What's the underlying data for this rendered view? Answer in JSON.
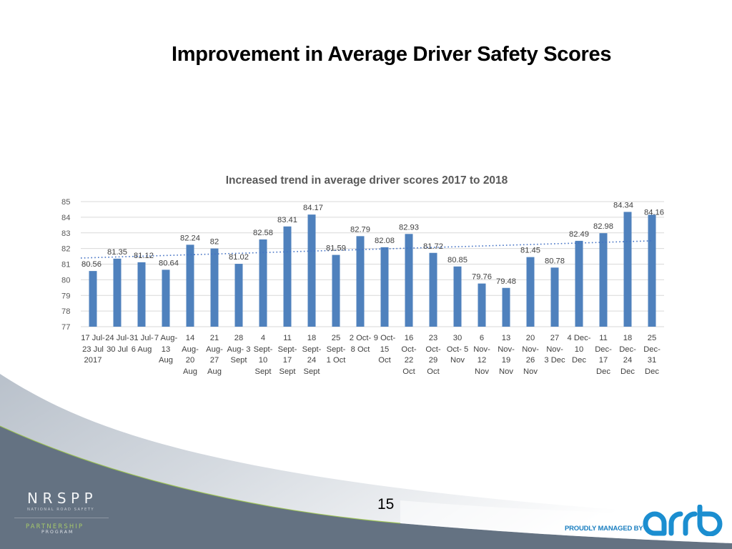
{
  "slide": {
    "title": "Improvement in Average Driver Safety Scores",
    "page_number": "15"
  },
  "branding": {
    "nrspp_name": "NRSPP",
    "nrspp_subtitle": "NATIONAL ROAD SAFETY",
    "nrspp_partnership": "PARTNERSHIP",
    "nrspp_program": "PROGRAM",
    "managed_by": "PROUDLY MANAGED BY",
    "arrb_logo_text": "arrb",
    "colors": {
      "footer_slate": "#647282",
      "footer_accent_green": "#9cc54a",
      "arrb_blue": "#1b8ed0"
    }
  },
  "chart_data": {
    "type": "bar",
    "title": "Increased trend in average driver scores 2017 to 2018",
    "xlabel": "",
    "ylabel": "",
    "ylim": [
      77,
      85
    ],
    "yticks": [
      77,
      78,
      79,
      80,
      81,
      82,
      83,
      84,
      85
    ],
    "grid": true,
    "legend": "none",
    "bar_color": "#4f81bd",
    "categories": [
      "17 Jul-\n23 Jul\n2017",
      "24 Jul-\n30 Jul",
      "31 Jul-\n6 Aug",
      "7 Aug-\n13\nAug",
      "14\nAug-\n20\nAug",
      "21\nAug-\n27\nAug",
      "28\nAug- 3\nSept",
      "4\nSept-\n10\nSept",
      "11\nSept-\n17\nSept",
      "18\nSept-\n24\nSept",
      "25\nSept-\n1 Oct",
      "2 Oct-\n8 Oct",
      "9 Oct-\n15\nOct",
      "16\nOct-\n22\nOct",
      "23\nOct-\n29\nOct",
      "30\nOct- 5\nNov",
      "6\nNov-\n12\nNov",
      "13\nNov-\n19\nNov",
      "20\nNov-\n26\nNov",
      "27\nNov-\n3 Dec",
      "4 Dec-\n10\nDec",
      "11\nDec-\n17\nDec",
      "18\nDec-\n24\nDec",
      "25\nDec-\n31\nDec"
    ],
    "values": [
      80.56,
      81.35,
      81.12,
      80.64,
      82.24,
      82,
      81.02,
      82.58,
      83.41,
      84.17,
      81.59,
      82.79,
      82.08,
      82.93,
      81.72,
      80.85,
      79.76,
      79.48,
      81.45,
      80.78,
      82.49,
      82.98,
      84.34,
      84.16
    ],
    "data_labels": [
      "80.56",
      "81.35",
      "81.12",
      "80.64",
      "82.24",
      "82",
      "81.02",
      "82.58",
      "83.41",
      "84.17",
      "81.59",
      "82.79",
      "82.08",
      "82.93",
      "81.72",
      "80.85",
      "79.76",
      "79.48",
      "81.45",
      "80.78",
      "82.49",
      "82.98",
      "84.34",
      "84.16"
    ],
    "trendline": {
      "type": "linear",
      "style": "dotted",
      "color": "#4472c4",
      "start_value": 81.39,
      "end_value": 82.49
    }
  }
}
